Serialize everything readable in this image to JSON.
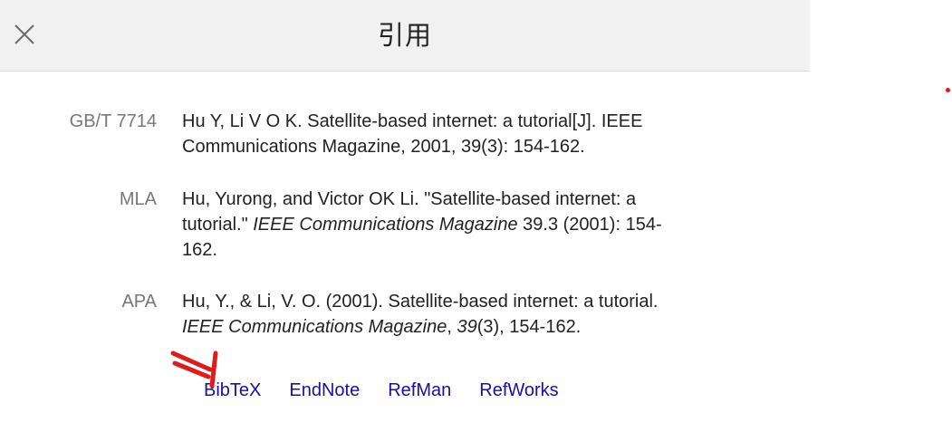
{
  "dialog": {
    "title": "引用",
    "close_icon": "close-icon"
  },
  "citations": [
    {
      "style": "GB/T 7714",
      "text_line1": "Hu Y, Li V O K. Satellite-based internet: a tutorial[J]. IEEE",
      "text_line2": "Communications Magazine, 2001, 39(3): 154-162."
    },
    {
      "style": "MLA",
      "part1": "Hu, Yurong, and Victor OK Li. \"Satellite-based internet: a",
      "part2": "tutorial.\" ",
      "journal": "IEEE Communications Magazine",
      "part3": " 39.3 (2001): 154-",
      "part4": "162."
    },
    {
      "style": "APA",
      "part1": "Hu, Y., & Li, V. O. (2001). Satellite-based internet: a tutorial.",
      "journal": "IEEE Communications Magazine",
      "sep": ", ",
      "volume": "39",
      "issue_pages": "(3), 154-162."
    }
  ],
  "export_links": [
    "BibTeX",
    "EndNote",
    "RefMan",
    "RefWorks"
  ],
  "annotations": {
    "arrow_color": "#e01b1b",
    "dot_color": "#e01b1b"
  }
}
